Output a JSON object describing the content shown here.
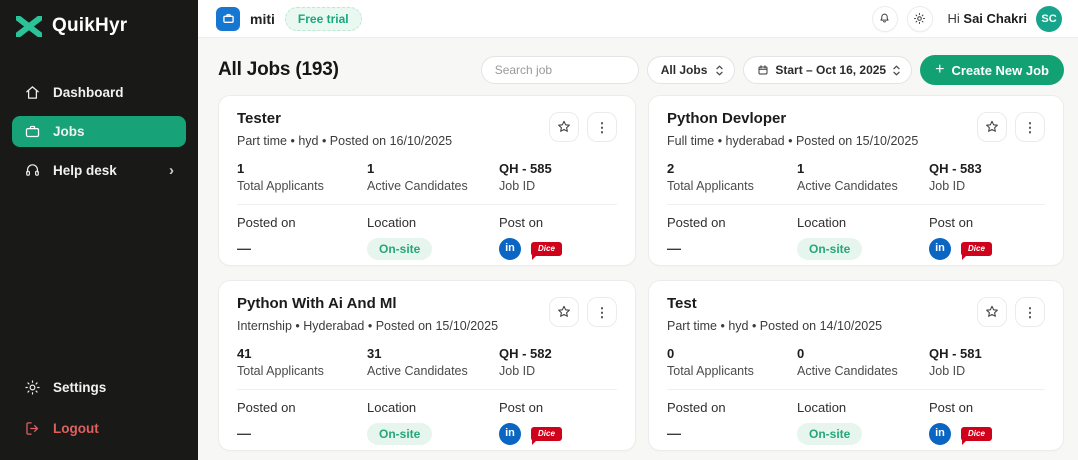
{
  "sidebar": {
    "logo_text": "QuikHyr",
    "items": [
      {
        "icon": "home-icon",
        "label": "Dashboard"
      },
      {
        "icon": "briefcase-icon",
        "label": "Jobs"
      },
      {
        "icon": "headset-icon",
        "label": "Help desk"
      }
    ],
    "footer_items": [
      {
        "icon": "gear-icon",
        "label": "Settings"
      },
      {
        "icon": "logout-icon",
        "label": "Logout"
      }
    ]
  },
  "topbar": {
    "org_name": "miti",
    "trial_badge": "Free trial",
    "greeting_prefix": "Hi ",
    "user_name": "Sai Chakri",
    "avatar_initials": "SC"
  },
  "toolbar": {
    "title": "All Jobs (193)",
    "search_placeholder": "Search job",
    "filter_value": "All Jobs",
    "date_value": "Start – Oct 16, 2025",
    "create_label": "Create New Job"
  },
  "cards": [
    {
      "title": "Tester",
      "meta": "Part time • hyd • Posted on 16/10/2025",
      "stats": [
        {
          "value": "1",
          "label": "Total Applicants"
        },
        {
          "value": "1",
          "label": "Active Candidates"
        },
        {
          "value": "QH - 585",
          "label": "Job ID"
        }
      ],
      "footer": {
        "posted_on_label": "Posted on",
        "posted_on_value": "—",
        "location_label": "Location",
        "location_value": "On-site",
        "post_on_label": "Post on"
      }
    },
    {
      "title": "Python Devloper",
      "meta": "Full time • hyderabad • Posted on 15/10/2025",
      "stats": [
        {
          "value": "2",
          "label": "Total Applicants"
        },
        {
          "value": "1",
          "label": "Active Candidates"
        },
        {
          "value": "QH - 583",
          "label": "Job ID"
        }
      ],
      "footer": {
        "posted_on_label": "Posted on",
        "posted_on_value": "—",
        "location_label": "Location",
        "location_value": "On-site",
        "post_on_label": "Post on"
      }
    },
    {
      "title": "Python With Ai And Ml",
      "meta": "Internship • Hyderabad • Posted on 15/10/2025",
      "stats": [
        {
          "value": "41",
          "label": "Total Applicants"
        },
        {
          "value": "31",
          "label": "Active Candidates"
        },
        {
          "value": "QH - 582",
          "label": "Job ID"
        }
      ],
      "footer": {
        "posted_on_label": "Posted on",
        "posted_on_value": "—",
        "location_label": "Location",
        "location_value": "On-site",
        "post_on_label": "Post on"
      }
    },
    {
      "title": "Test",
      "meta": "Part time • hyd • Posted on 14/10/2025",
      "stats": [
        {
          "value": "0",
          "label": "Total Applicants"
        },
        {
          "value": "0",
          "label": "Active Candidates"
        },
        {
          "value": "QH - 581",
          "label": "Job ID"
        }
      ],
      "footer": {
        "posted_on_label": "Posted on",
        "posted_on_value": "—",
        "location_label": "Location",
        "location_value": "On-site",
        "post_on_label": "Post on"
      }
    }
  ],
  "icons": {
    "chevron_right": "›",
    "plus": "+",
    "kebab": "⋮",
    "linkedin_label": "in",
    "dice_label": "Dice"
  },
  "colors": {
    "accent_green": "#17a277",
    "button_green": "#12a173",
    "logo_green": "#2bc499",
    "sidebar_bg": "#191917",
    "logout_red": "#e06060",
    "linkedin_blue": "#0a66c2",
    "dice_red": "#d0021b",
    "org_icon_blue": "#1677d2",
    "avatar_teal": "#16a58b"
  }
}
